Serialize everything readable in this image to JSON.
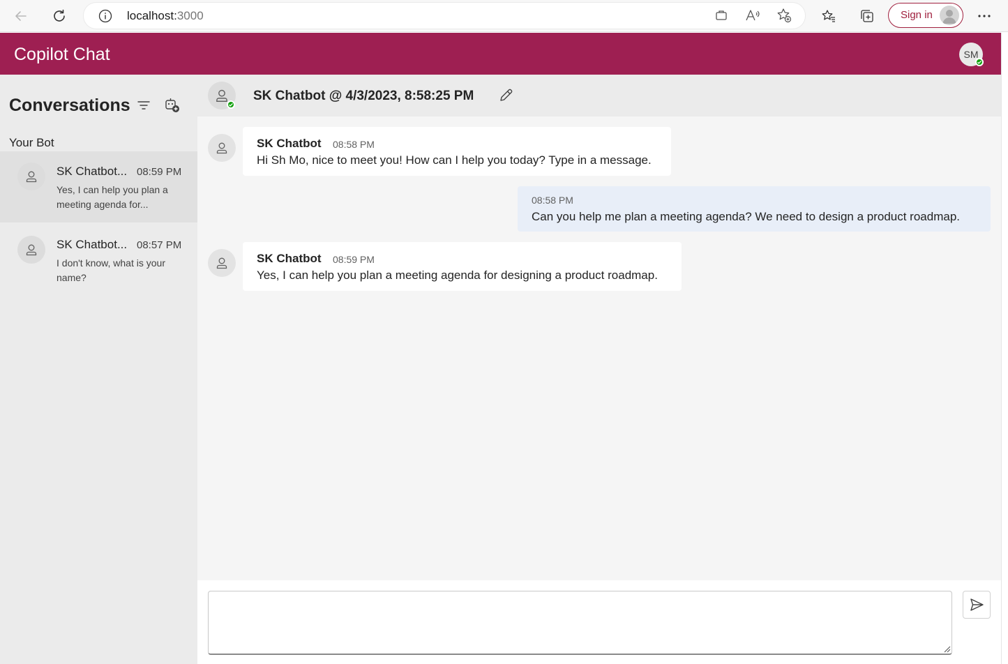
{
  "browser": {
    "url_host": "localhost:",
    "url_port": "3000",
    "sign_in_label": "Sign in"
  },
  "app": {
    "title": "Copilot Chat",
    "user_initials": "SM",
    "brand_color": "#9e1f52"
  },
  "sidebar": {
    "title": "Conversations",
    "section_label": "Your Bot",
    "conversations": [
      {
        "name": "SK Chatbot...",
        "time": "08:59 PM",
        "preview": "Yes, I can help you plan a meeting agenda for...",
        "selected": true
      },
      {
        "name": "SK Chatbot...",
        "time": "08:57 PM",
        "preview": "I don't know, what is your name?",
        "selected": false
      }
    ]
  },
  "chat": {
    "title": "SK Chatbot @ 4/3/2023, 8:58:25 PM",
    "messages": [
      {
        "sender": "SK Chatbot",
        "time": "08:58 PM",
        "text": "Hi Sh Mo, nice to meet you! How can I help you today? Type in a message.",
        "from_user": false
      },
      {
        "sender": "",
        "time": "08:58 PM",
        "text": "Can you help me plan a meeting agenda?   We need to design a product roadmap.",
        "from_user": true
      },
      {
        "sender": "SK Chatbot",
        "time": "08:59 PM",
        "text": "Yes, I can help you plan a meeting agenda for designing a product roadmap.",
        "from_user": false
      }
    ],
    "composer_value": "",
    "composer_placeholder": ""
  },
  "icons": {
    "back": "back-arrow-icon",
    "refresh": "refresh-icon",
    "info": "info-icon",
    "apps": "app-available-icon",
    "read_aloud": "read-aloud-icon",
    "add_favorite": "add-favorite-icon",
    "favorites": "favorites-icon",
    "collections": "collections-icon",
    "more": "more-icon",
    "filter": "filter-icon",
    "new_chat": "new-bot-chat-icon",
    "edit": "edit-pencil-icon",
    "send": "send-icon",
    "bot": "bot-person-icon"
  }
}
